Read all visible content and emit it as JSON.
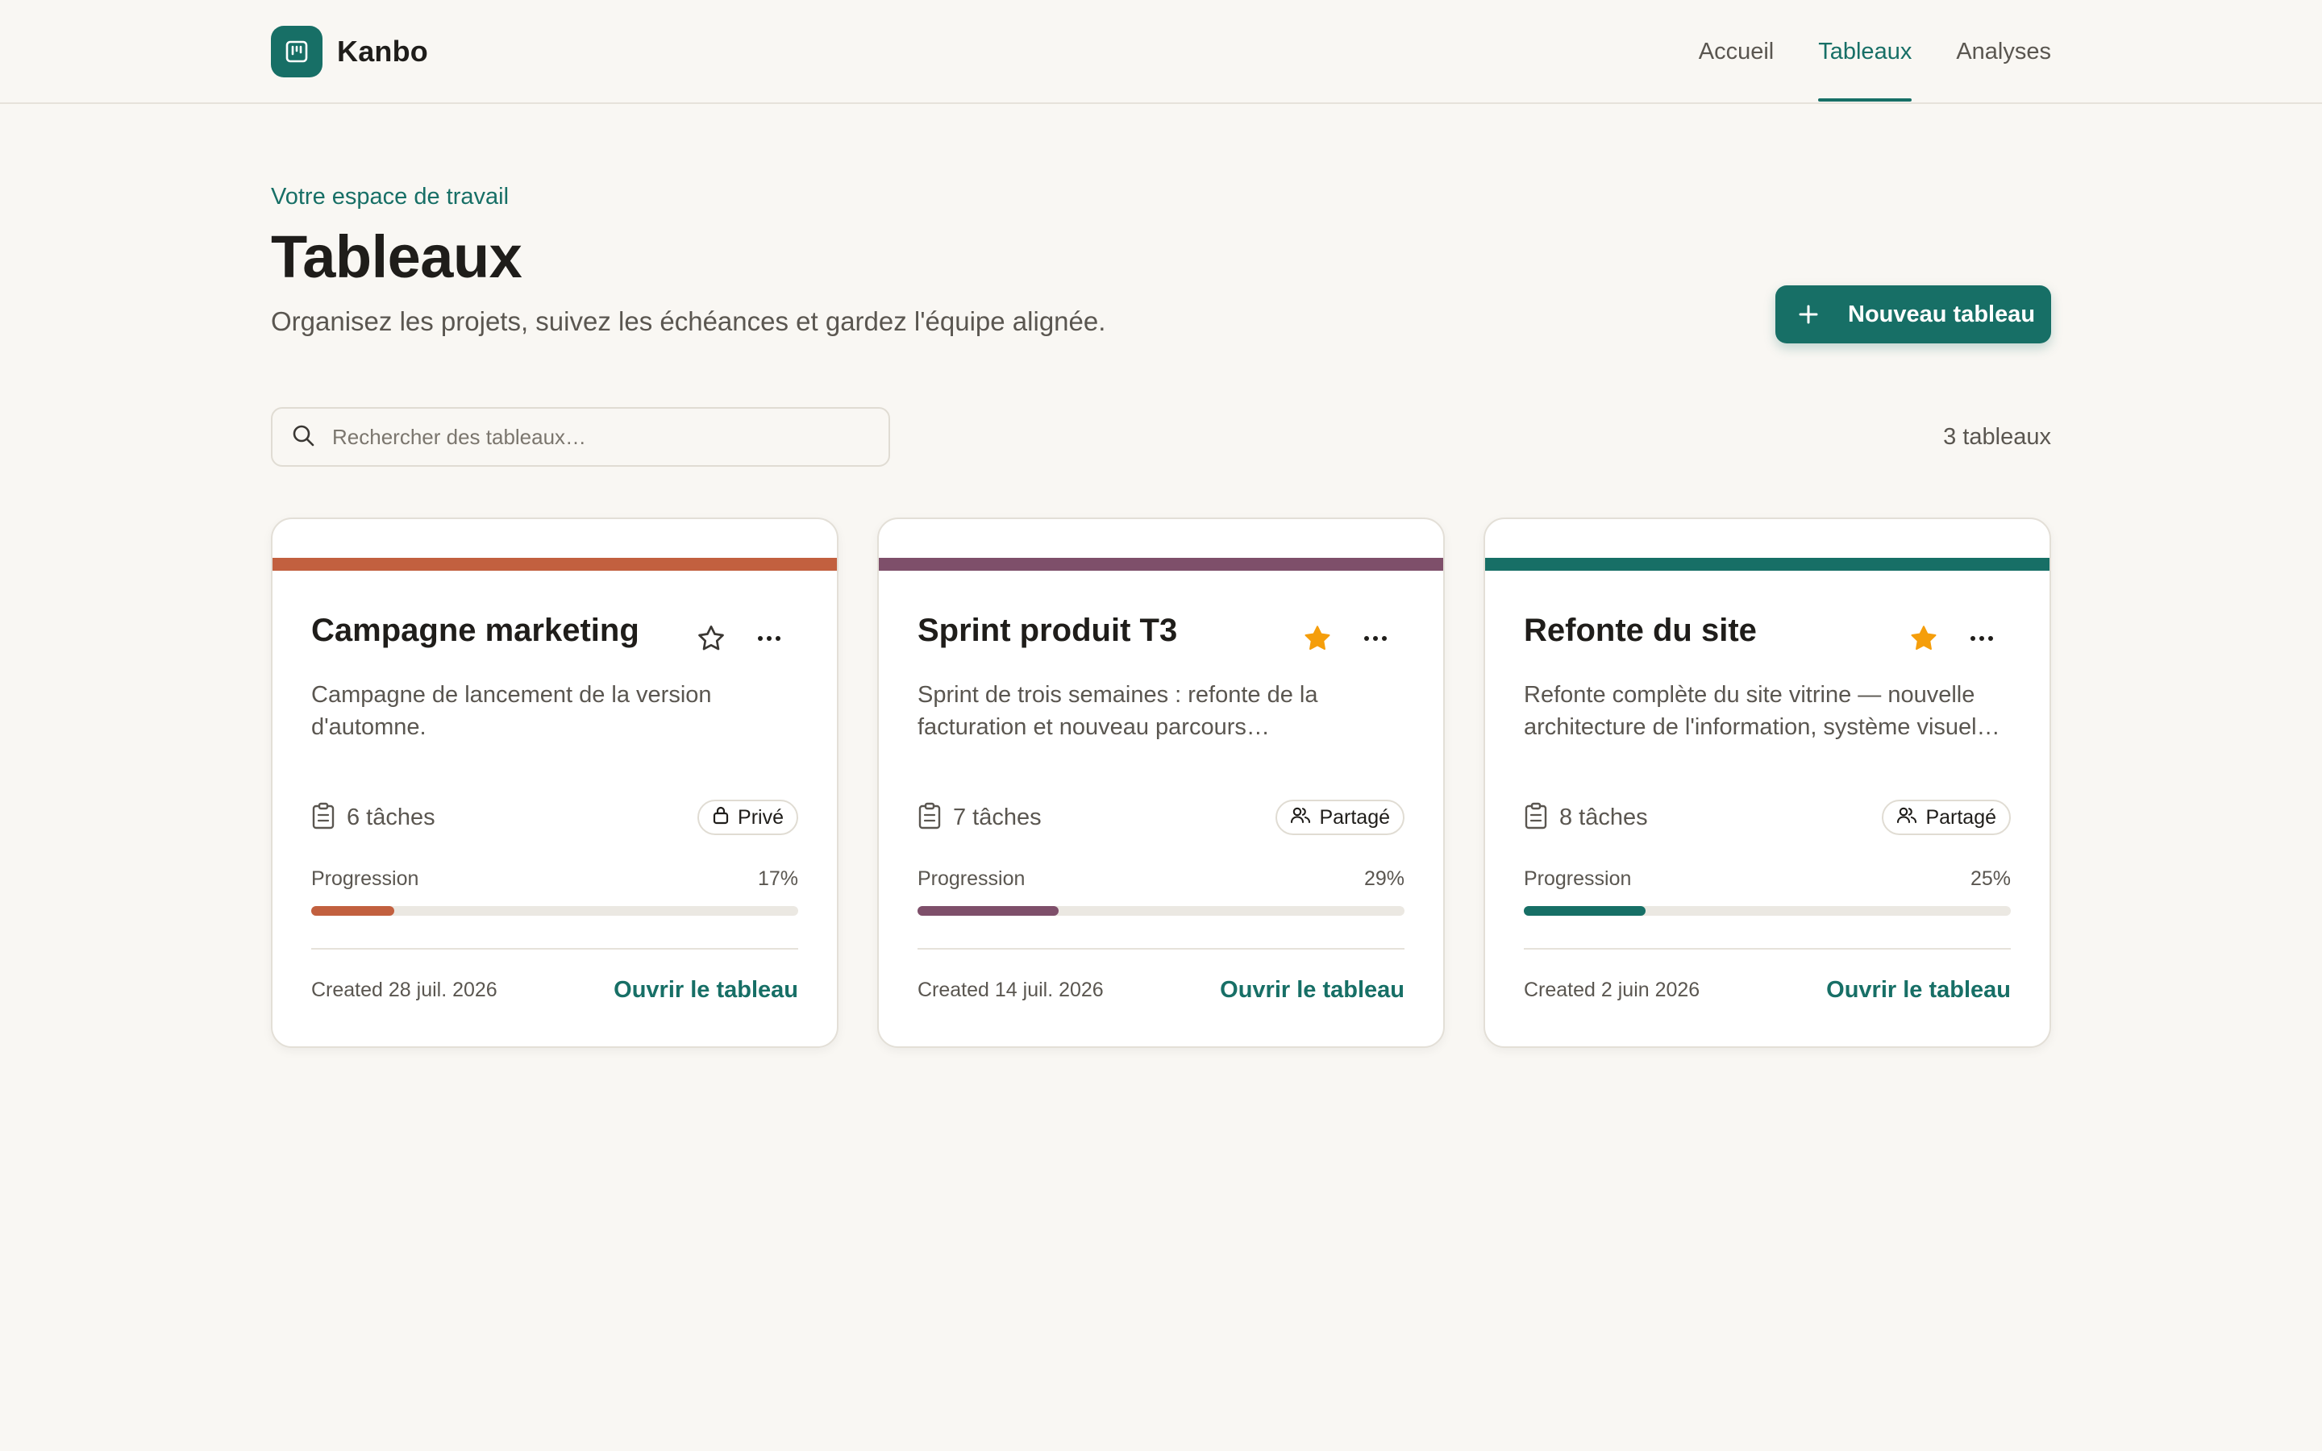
{
  "app": {
    "name": "Kanbo",
    "logo_icon": "kanban-board-icon",
    "accent_color": "#176f66"
  },
  "nav": {
    "items": [
      {
        "label": "Accueil",
        "active": false
      },
      {
        "label": "Tableaux",
        "active": true
      },
      {
        "label": "Analyses",
        "active": false
      }
    ]
  },
  "header": {
    "eyebrow": "Votre espace de travail",
    "title": "Tableaux",
    "subtitle": "Organisez les projets, suivez les échéances et gardez l'équipe alignée.",
    "new_button": {
      "label": "Nouveau tableau",
      "icon": "plus-icon"
    }
  },
  "search": {
    "placeholder": "Rechercher des tableaux…",
    "value": "",
    "icon": "search-icon"
  },
  "count_label": "3 tableaux",
  "cards": [
    {
      "title": "Campagne marketing",
      "description": "Campagne de lancement de la version d'automne.",
      "color": "#c2603f",
      "starred": false,
      "tasks_label": "6 tâches",
      "visibility": "Privé",
      "visibility_icon": "lock-icon",
      "progress_label": "Progression",
      "progress": 17,
      "progress_text": "17%",
      "created": "Created 28 juil. 2026",
      "open_label": "Ouvrir le tableau"
    },
    {
      "title": "Sprint produit T3",
      "description": "Sprint de trois semaines : refonte de la facturation et nouveau parcours…",
      "color": "#7e4f6a",
      "starred": true,
      "tasks_label": "7 tâches",
      "visibility": "Partagé",
      "visibility_icon": "users-icon",
      "progress_label": "Progression",
      "progress": 29,
      "progress_text": "29%",
      "created": "Created 14 juil. 2026",
      "open_label": "Ouvrir le tableau"
    },
    {
      "title": "Refonte du site",
      "description": "Refonte complète du site vitrine — nouvelle architecture de l'information, système visuel…",
      "color": "#176f66",
      "starred": true,
      "tasks_label": "8 tâches",
      "visibility": "Partagé",
      "visibility_icon": "users-icon",
      "progress_label": "Progression",
      "progress": 25,
      "progress_text": "25%",
      "created": "Created 2 juin 2026",
      "open_label": "Ouvrir le tableau"
    }
  ],
  "colors": {
    "star_on": "#f59e0b",
    "star_off": "#3a3733"
  }
}
